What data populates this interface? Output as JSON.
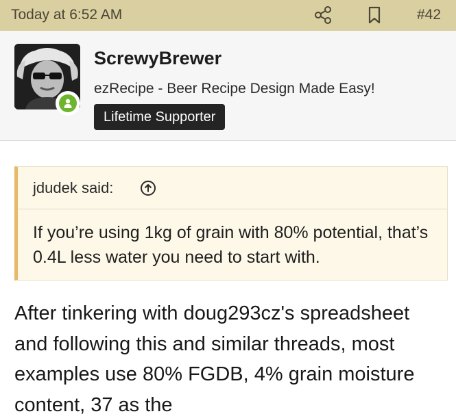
{
  "topbar": {
    "timestamp": "Today at 6:52 AM",
    "post_number": "#42",
    "icons": {
      "share": "share-icon",
      "bookmark": "bookmark-icon"
    },
    "background": "#d9cfa1"
  },
  "user": {
    "name": "ScrewyBrewer",
    "title": "ezRecipe - Beer Recipe Design Made Easy!",
    "banner": "Lifetime Supporter",
    "online_status_color": "#6cb52d"
  },
  "quote": {
    "attribution": "jdudek said:",
    "text": "If you’re using 1kg of grain with 80% potential, that’s 0.4L less water you need to start with.",
    "accent_color": "#e8b96a"
  },
  "post": {
    "body": "After tinkering with doug293cz's spreadsheet and following this and similar threads, most examples use 80% FGDB, 4% grain moisture content, 37 as the"
  }
}
